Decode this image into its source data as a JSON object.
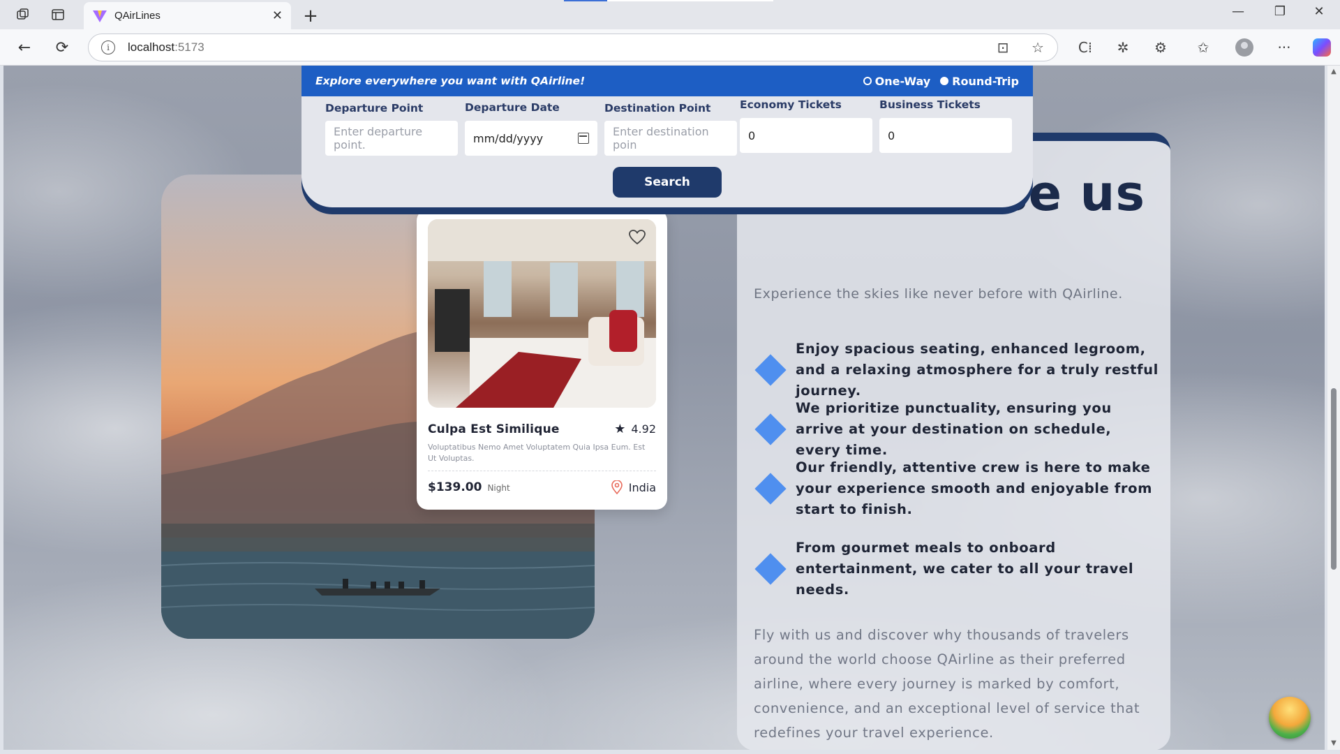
{
  "browser": {
    "tab_title": "QAirLines",
    "url_host": "localhost",
    "url_port": ":5173"
  },
  "search": {
    "tagline": "Explore everywhere you want with QAirline!",
    "trip_types": [
      "One-Way",
      "Round-Trip"
    ],
    "selected_trip": "Round-Trip",
    "departure_point": {
      "label": "Departure Point",
      "placeholder": "Enter departure point."
    },
    "departure_date": {
      "label": "Departure Date",
      "placeholder": "mm/dd/yyyy"
    },
    "destination_point": {
      "label": "Destination Point",
      "placeholder": "Enter destination poin"
    },
    "economy_tickets": {
      "label": "Economy Tickets",
      "value": "0"
    },
    "business_tickets": {
      "label": "Business Tickets",
      "value": "0"
    },
    "search_label": "Search"
  },
  "hotel": {
    "name": "Culpa Est Similique",
    "rating": "4.92",
    "description": "Voluptatibus Nemo Amet Voluptatem Quia Ipsa Eum. Est Ut Voluptas.",
    "price": "$139.00",
    "price_unit": "Night",
    "location": "India"
  },
  "choose": {
    "heading": "se us",
    "subtitle": "Experience the skies like never before with QAirline.",
    "features": [
      "Enjoy spacious seating, enhanced legroom, and a relaxing atmosphere for a truly restful journey.",
      "We prioritize punctuality, ensuring you arrive at your destination on schedule, every time.",
      "Our friendly, attentive crew is here to make your experience smooth and enjoyable from start to finish.",
      "From gourmet meals to onboard entertainment, we cater to all your travel needs."
    ],
    "paragraph": "Fly with us and discover why thousands of travelers around the world choose QAirline as their preferred airline, where every journey is marked by comfort, convenience, and an exceptional level of service that redefines your travel experience."
  },
  "colors": {
    "brand_navy": "#1f3a6b",
    "header_blue": "#1d5ec4",
    "feature_diamond": "#4f8fef"
  }
}
